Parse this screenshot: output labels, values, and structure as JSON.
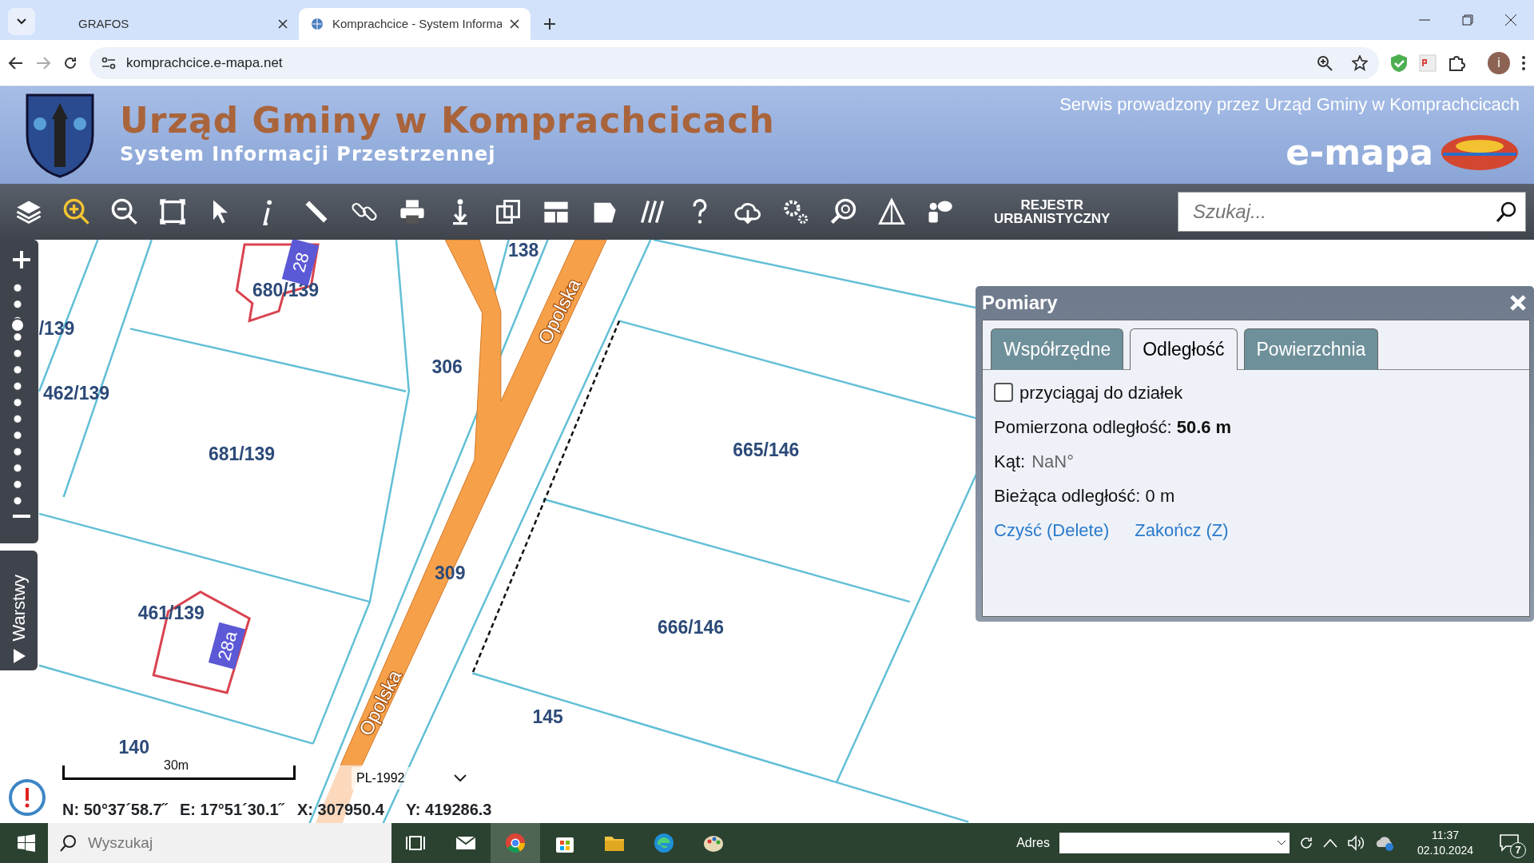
{
  "browser": {
    "tabs": [
      {
        "title": "GRAFOS",
        "selected": false
      },
      {
        "title": "Komprachcice - System Informa",
        "selected": true
      }
    ],
    "url": "komprachcice.e-mapa.net",
    "profile_initial": "i"
  },
  "header": {
    "title": "Urząd Gminy w Komprachcicach",
    "subtitle": "System Informacji Przestrzennej",
    "service": "Serwis prowadzony przez Urząd Gminy w Komprachcicach",
    "logo": "e-mapa"
  },
  "toolbar": {
    "tools": [
      {
        "kind": "layers",
        "selected": false
      },
      {
        "kind": "zoomin",
        "selected": true
      },
      {
        "kind": "zoomout",
        "selected": false
      },
      {
        "kind": "extent",
        "selected": false
      },
      {
        "kind": "pointer",
        "selected": false
      },
      {
        "kind": "info",
        "selected": false
      },
      {
        "kind": "ruler",
        "selected": false
      },
      {
        "kind": "link",
        "selected": false
      },
      {
        "kind": "print",
        "selected": false
      },
      {
        "kind": "download",
        "selected": false
      },
      {
        "kind": "copy",
        "selected": false
      },
      {
        "kind": "layout",
        "selected": false
      },
      {
        "kind": "shape",
        "selected": false
      },
      {
        "kind": "hatch",
        "selected": false
      },
      {
        "kind": "help",
        "selected": false
      },
      {
        "kind": "cloud",
        "selected": false
      },
      {
        "kind": "gears",
        "selected": false
      },
      {
        "kind": "magnifier",
        "selected": false
      },
      {
        "kind": "warning",
        "selected": false
      },
      {
        "kind": "chat",
        "selected": false
      }
    ],
    "register": [
      "REJESTR",
      "URBANISTYCZNY"
    ],
    "search": {
      "placeholder": "Szukaj..."
    }
  },
  "map": {
    "zoom_slider": {
      "level": 0.82
    },
    "layers_tab": "Warstwy",
    "labels": [
      "138",
      "680/139",
      "/139",
      "306",
      "462/139",
      "681/139",
      "665/146",
      "309",
      "461/139",
      "666/146",
      "145",
      "140"
    ],
    "streets": [
      "Opolska",
      "Opolska"
    ],
    "house_numbers": [
      "28",
      "28a"
    ]
  },
  "panel": {
    "title": "Pomiary",
    "tabs": [
      {
        "label": "Współrzędne",
        "selected": false
      },
      {
        "label": "Odległość",
        "selected": true
      },
      {
        "label": "Powierzchnia",
        "selected": false
      }
    ],
    "snap": {
      "label": "przyciągaj do działek",
      "checked": false
    },
    "measured": "Pomierzona odległość: **50.6 m**",
    "angle": {
      "label": "Kąt:",
      "value": "NaN°"
    },
    "current": "Bieżąca odległość: 0 m",
    "links": [
      "Czyść (Delete)",
      "Zakończ (Z)"
    ]
  },
  "status": {
    "scale": "30m",
    "crs": "PL-1992",
    "coords": [
      "N: 50°37´58.7˝",
      "E: 17°51´30.1˝",
      "X: 307950.4",
      "Y: 419286.3"
    ]
  },
  "taskbar": {
    "search_placeholder": "Wyszukaj",
    "apps": [
      {
        "kind": "taskview",
        "selected": false
      },
      {
        "kind": "mail",
        "selected": false
      },
      {
        "kind": "chrome",
        "selected": true
      },
      {
        "kind": "store",
        "selected": false
      },
      {
        "kind": "folder",
        "selected": false
      },
      {
        "kind": "edge",
        "selected": false
      },
      {
        "kind": "paint",
        "selected": false
      }
    ],
    "address_label": "Adres",
    "time": "11:37",
    "date": "02.10.2024",
    "notifications": "7"
  }
}
